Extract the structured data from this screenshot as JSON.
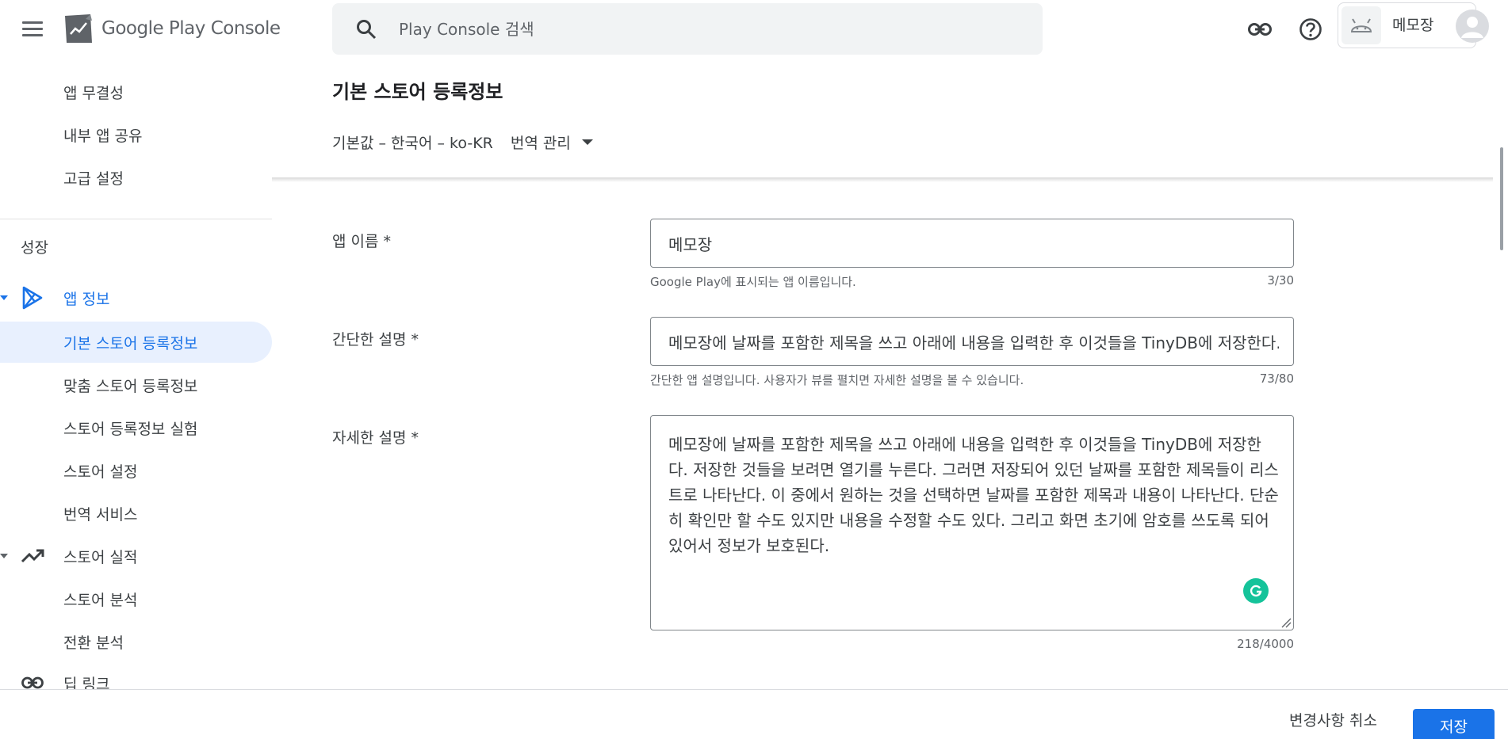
{
  "topbar": {
    "logo_text_google": "Google",
    "logo_text_product": "Play Console",
    "search_placeholder": "Play Console 검색",
    "app_name": "메모장"
  },
  "sidebar": {
    "items_top": [
      {
        "label": "앱 무결성"
      },
      {
        "label": "내부 앱 공유"
      },
      {
        "label": "고급 설정"
      }
    ],
    "section_label": "성장",
    "app_info_label": "앱 정보",
    "items_app_info": [
      {
        "label": "기본 스토어 등록정보",
        "active": true
      },
      {
        "label": "맞춤 스토어 등록정보"
      },
      {
        "label": "스토어 등록정보 실험"
      },
      {
        "label": "스토어 설정"
      },
      {
        "label": "번역 서비스"
      }
    ],
    "store_perf_label": "스토어 실적",
    "items_store_perf": [
      {
        "label": "스토어 분석"
      },
      {
        "label": "전환 분석"
      }
    ],
    "deep_link_label": "딥 링크"
  },
  "main": {
    "page_title": "기본 스토어 등록정보",
    "default_lang": "기본값 – 한국어 – ko-KR",
    "translation_manage": "번역 관리",
    "fields": {
      "app_name": {
        "label": "앱 이름",
        "required": "*",
        "value": "메모장",
        "helper": "Google Play에 표시되는 앱 이름입니다.",
        "counter": "3/30"
      },
      "short_desc": {
        "label": "간단한 설명",
        "required": "*",
        "value": "메모장에 날짜를 포함한 제목을 쓰고 아래에 내용을 입력한 후 이것들을 TinyDB에 저장한다.",
        "helper": "간단한 앱 설명입니다. 사용자가 뷰를 펼치면 자세한 설명을 볼 수 있습니다.",
        "counter": "73/80"
      },
      "full_desc": {
        "label": "자세한 설명",
        "required": "*",
        "value": "메모장에 날짜를 포함한 제목을 쓰고 아래에 내용을 입력한 후 이것들을 TinyDB에 저장한다. 저장한 것들을 보려면 열기를 누른다. 그러면 저장되어 있던 날짜를 포함한 제목들이 리스트로 나타난다. 이 중에서 원하는 것을 선택하면 날짜를 포함한 제목과 내용이 나타난다. 단순히 확인만 할 수도 있지만 내용을 수정할 수도 있다. 그리고 화면 초기에 암호를 쓰도록 되어 있어서 정보가 보호된다.",
        "counter": "218/4000"
      }
    }
  },
  "bottombar": {
    "discard_label": "변경사항 취소",
    "save_label": "저장"
  },
  "colors": {
    "accent": "#1a73e8",
    "active_bg": "#e8f0fe",
    "grammarly": "#15c39a"
  }
}
